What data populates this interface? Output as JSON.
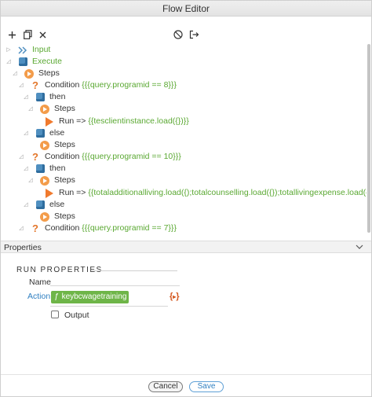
{
  "window": {
    "title": "Flow Editor"
  },
  "toolbar": {
    "add_icon": "plus-icon",
    "copy_icon": "copy-icon",
    "delete_icon": "close-icon",
    "disable_icon": "no-entry-icon",
    "export_icon": "export-icon"
  },
  "tree": {
    "input_label": "Input",
    "execute_label": "Execute",
    "steps_label": "Steps",
    "then_label": "then",
    "else_label": "else",
    "condition_word": "Condition",
    "run_word": "Run =>",
    "cond1_expr": "{{{query.programid == 8}}}",
    "run1_expr": "{{tesclientinstance.load({})}}",
    "cond2_expr": "{{{query.programid == 10}}}",
    "run2_expr": "{{totaladditionalliving.load({);totalcounselling.load({});totallivingexpense.load({});totaltransportation.load({});tota",
    "cond3_expr": "{{{query.programid == 7}}}"
  },
  "properties": {
    "header": "Properties",
    "section": "RUN PROPERTIES",
    "name_label": "Name",
    "action_label": "Action",
    "action_chip": "keybcwagetraining",
    "output_label": "Output",
    "output_checked": false
  },
  "footer": {
    "cancel_label": "Cancel",
    "save_label": "Save"
  },
  "colors": {
    "accent_green": "#5aa832",
    "chip_green": "#6eb548",
    "orange": "#f07a2e",
    "blue": "#4f8fc0"
  }
}
